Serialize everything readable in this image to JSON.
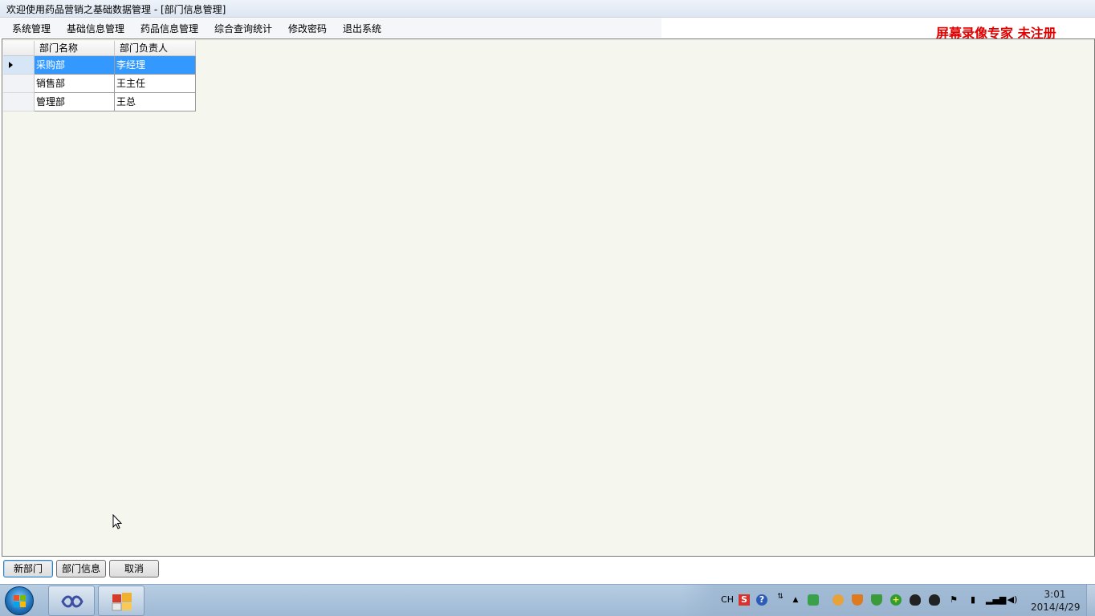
{
  "window": {
    "title": "欢迎使用药品营销之基础数据管理 - [部门信息管理]"
  },
  "menu": [
    {
      "label": "系统管理"
    },
    {
      "label": "基础信息管理"
    },
    {
      "label": "药品信息管理"
    },
    {
      "label": "综合查询统计"
    },
    {
      "label": "修改密码"
    },
    {
      "label": "退出系统"
    }
  ],
  "watermark": "屏幕录像专家 未注册",
  "grid": {
    "columns": [
      "部门名称",
      "部门负责人"
    ],
    "rows": [
      {
        "name": "采购部",
        "manager": "李经理",
        "selected": true
      },
      {
        "name": "销售部",
        "manager": "王主任",
        "selected": false
      },
      {
        "name": "管理部",
        "manager": "王总",
        "selected": false
      }
    ]
  },
  "buttons": {
    "new_dept": "新部门",
    "dept_info": "部门信息",
    "cancel": "取消"
  },
  "taskbar": {
    "tray_lang": "CH",
    "clock_time": "3:01",
    "clock_date": "2014/4/29"
  },
  "colors": {
    "selection": "#3399ff",
    "panel_bg": "#f5f6ee",
    "watermark": "#e20000"
  },
  "icons": [
    "start-orb-icon",
    "visual-studio-icon",
    "app-window-icon",
    "sogou-s-icon",
    "help-icon",
    "network-icon",
    "shield-icon",
    "qq-icon",
    "action-center-flag-icon",
    "power-icon",
    "signal-icon",
    "volume-icon"
  ]
}
